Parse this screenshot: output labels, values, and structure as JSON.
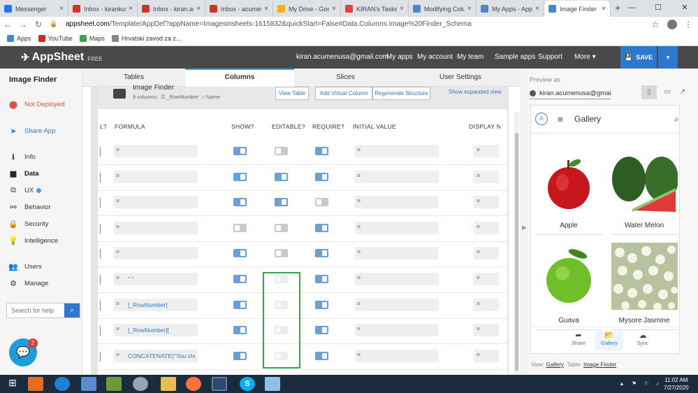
{
  "browser": {
    "tabs": [
      {
        "title": "Messenger",
        "color": "#1877f2"
      },
      {
        "title": "Inbox - kirankum",
        "color": "#d93025"
      },
      {
        "title": "Inbox - kiran.ac",
        "color": "#d93025"
      },
      {
        "title": "Inbox - acumen",
        "color": "#d93025"
      },
      {
        "title": "My Drive - Goo",
        "color": "#f4b400"
      },
      {
        "title": "KIRAN's Tasks",
        "color": "#e44332"
      },
      {
        "title": "Modifying Colu",
        "color": "#4a86c8"
      },
      {
        "title": "My Apps - Apps",
        "color": "#4a86c8"
      },
      {
        "title": "Image Finder -",
        "color": "#4a86c8"
      }
    ],
    "close_glyph": "×",
    "new_tab": "+",
    "url_domain": "appsheet.com",
    "url_path": "/Template/AppDef?appName=Imagesinsheets-1615832&quickStart=False#Data.Columns.Image%20Finder_Schema",
    "bookmarks": [
      {
        "label": "Apps",
        "color": "#4a86c8"
      },
      {
        "label": "YouTube",
        "color": "#e62117"
      },
      {
        "label": "Maps",
        "color": "#34a853"
      },
      {
        "label": "Hrvatski zavod za z...",
        "color": "#888888"
      }
    ]
  },
  "header": {
    "logo": "AppSheet",
    "logo_badge": "FREE",
    "email": "kiran.acumenusa@gmail.com",
    "links": [
      "My apps",
      "My account",
      "My team",
      "Sample apps",
      "Support",
      "More"
    ],
    "save_label": "SAVE"
  },
  "sidebar": {
    "app_title": "Image Finder",
    "items": [
      {
        "label": "Not Deployed",
        "icon": "alert-icon"
      },
      {
        "label": "Share App",
        "icon": "share-icon"
      },
      {
        "label": "Info",
        "icon": "info-icon"
      },
      {
        "label": "Data",
        "icon": "data-icon"
      },
      {
        "label": "UX",
        "icon": "ux-icon"
      },
      {
        "label": "Behavior",
        "icon": "behavior-icon"
      },
      {
        "label": "Security",
        "icon": "lock-icon"
      },
      {
        "label": "Intelligence",
        "icon": "bulb-icon"
      },
      {
        "label": "Users",
        "icon": "users-icon"
      },
      {
        "label": "Manage",
        "icon": "gear-icon"
      }
    ],
    "search_placeholder": "Search for help",
    "chat_badge": "2"
  },
  "tabs": [
    "Tables",
    "Columns",
    "Slices",
    "User Settings"
  ],
  "table": {
    "name": "Image Finder",
    "meta": "9 columns:",
    "meta_key": "_RowNumber",
    "meta_label": "Name",
    "buttons": [
      "View Table",
      "Add Virtual Column",
      "Regenerate Structure"
    ],
    "show_expanded": "Show expanded view",
    "headers": [
      "L?",
      "FORMULA",
      "SHOW?",
      "EDITABLE?",
      "REQUIRE?",
      "INITIAL VALUE",
      "DISPLAY N."
    ],
    "eq": "=",
    "rows": [
      {
        "formula": "",
        "show": "on",
        "editable": "off",
        "require": "on"
      },
      {
        "formula": "",
        "show": "on",
        "editable": "on",
        "require": "on"
      },
      {
        "formula": "",
        "show": "on",
        "editable": "on",
        "require": "off"
      },
      {
        "formula": "",
        "show": "off",
        "editable": "off",
        "require": "on"
      },
      {
        "formula": "",
        "show": "on",
        "editable": "off",
        "require": "on"
      },
      {
        "formula": "\" \"",
        "show": "on",
        "editable": "faint",
        "require": "on"
      },
      {
        "formula": "[_RowNumber]",
        "show": "on",
        "editable": "faint",
        "require": "on"
      },
      {
        "formula": "[_RowNumber][",
        "show": "on",
        "editable": "faint",
        "require": "on"
      },
      {
        "formula": "CONCATENATE(\"You cho",
        "show": "on",
        "editable": "faint",
        "require": "on"
      }
    ]
  },
  "preview": {
    "label": "Preview as",
    "user": "kiran.acumenusa@gmai",
    "gallery_title": "Gallery",
    "items": [
      "Apple",
      "Water Melon",
      "Guava",
      "Mysore Jasmine"
    ],
    "footer": [
      "Share",
      "Gallery",
      "Sync"
    ],
    "view_label": "View:",
    "view_value": "Gallery",
    "table_label": "Table:",
    "table_value": "Image Finder"
  },
  "taskbar": {
    "time": "11:02 AM",
    "date": "7/27/2020"
  }
}
